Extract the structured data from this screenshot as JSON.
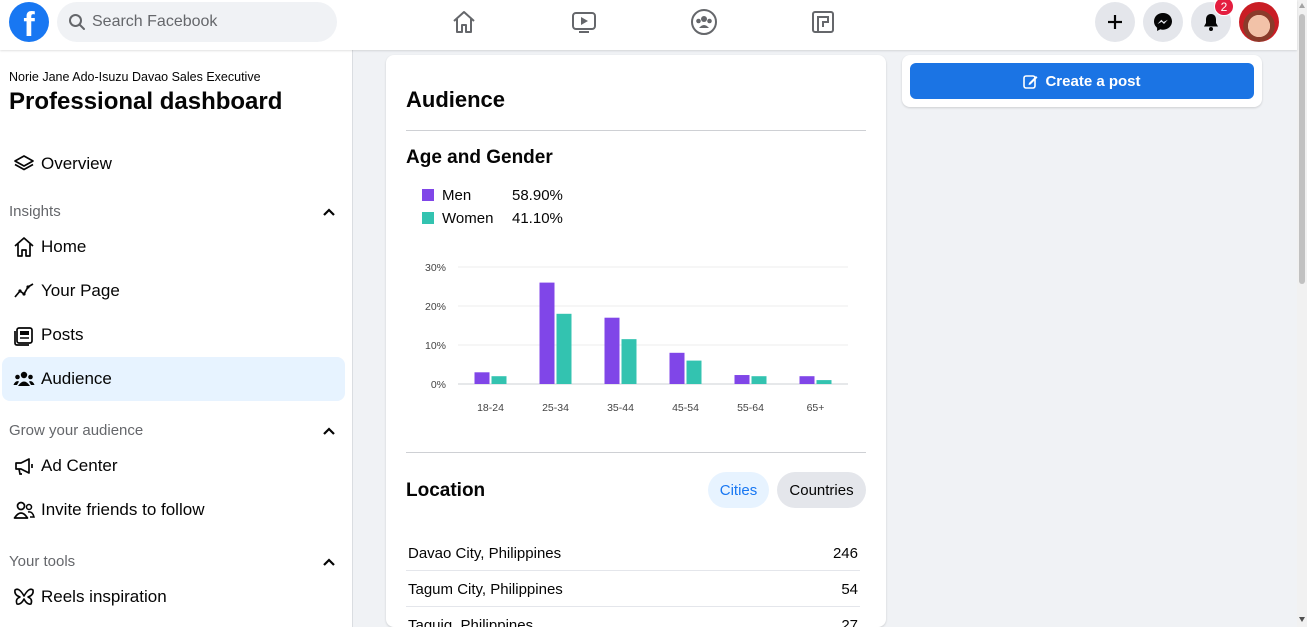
{
  "search": {
    "placeholder": "Search Facebook"
  },
  "nav": {
    "icons": [
      "home-icon",
      "video-icon",
      "groups-icon",
      "gaming-icon"
    ],
    "notifications_count": "2"
  },
  "colors": {
    "brand": "#1877f2",
    "men": "#8046e8",
    "women": "#33c3b0",
    "active_bg": "#e7f3ff"
  },
  "sidebar": {
    "subtitle": "Norie Jane Ado-Isuzu Davao Sales Executive",
    "title": "Professional dashboard",
    "overview": "Overview",
    "insights_heading": "Insights",
    "insights_items": [
      "Home",
      "Your Page",
      "Posts",
      "Audience"
    ],
    "grow_heading": "Grow your audience",
    "grow_items": [
      "Ad Center",
      "Invite friends to follow"
    ],
    "tools_heading": "Your tools",
    "tools_items": [
      "Reels inspiration"
    ]
  },
  "main": {
    "title": "Audience",
    "age_gender_heading": "Age and Gender",
    "legend": [
      {
        "name": "Men",
        "percent": "58.90%"
      },
      {
        "name": "Women",
        "percent": "41.10%"
      }
    ],
    "location_heading": "Location",
    "location_tabs": [
      "Cities",
      "Countries"
    ],
    "locations": [
      {
        "city": "Davao City, Philippines",
        "count": "246"
      },
      {
        "city": "Tagum City, Philippines",
        "count": "54"
      },
      {
        "city": "Taguig, Philippines",
        "count": "27"
      }
    ]
  },
  "right": {
    "create_post_label": "Create a post"
  },
  "chart_data": {
    "type": "bar",
    "categories": [
      "18-24",
      "25-34",
      "35-44",
      "45-54",
      "55-64",
      "65+"
    ],
    "y_ticks": [
      "0%",
      "10%",
      "20%",
      "30%"
    ],
    "ylim": [
      0,
      30
    ],
    "grid": true,
    "series": [
      {
        "name": "Men",
        "values": [
          3,
          26,
          17,
          8,
          2.3,
          2
        ]
      },
      {
        "name": "Women",
        "values": [
          2,
          18,
          11.5,
          6,
          2,
          1
        ]
      }
    ]
  }
}
